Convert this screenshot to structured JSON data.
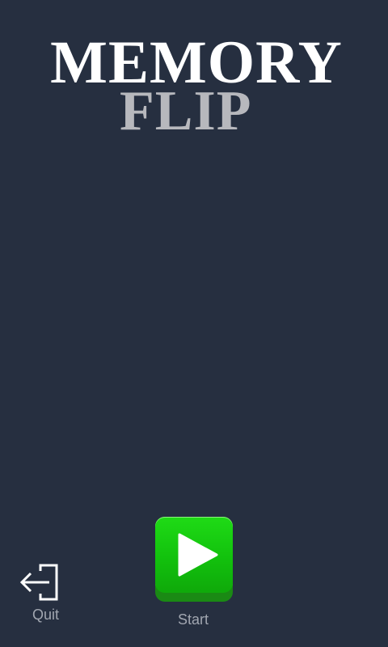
{
  "title": {
    "line1": "MEMORY",
    "line2": "FLIP"
  },
  "buttons": {
    "quit": {
      "label": "Quit",
      "icon": "exit-icon"
    },
    "start": {
      "label": "Start",
      "icon": "play-icon"
    }
  },
  "colors": {
    "background": "#262f40",
    "title_primary": "#ffffff",
    "title_secondary": "#b7b8bd",
    "start_button": "#12c10d",
    "label": "#a1a6b0"
  }
}
